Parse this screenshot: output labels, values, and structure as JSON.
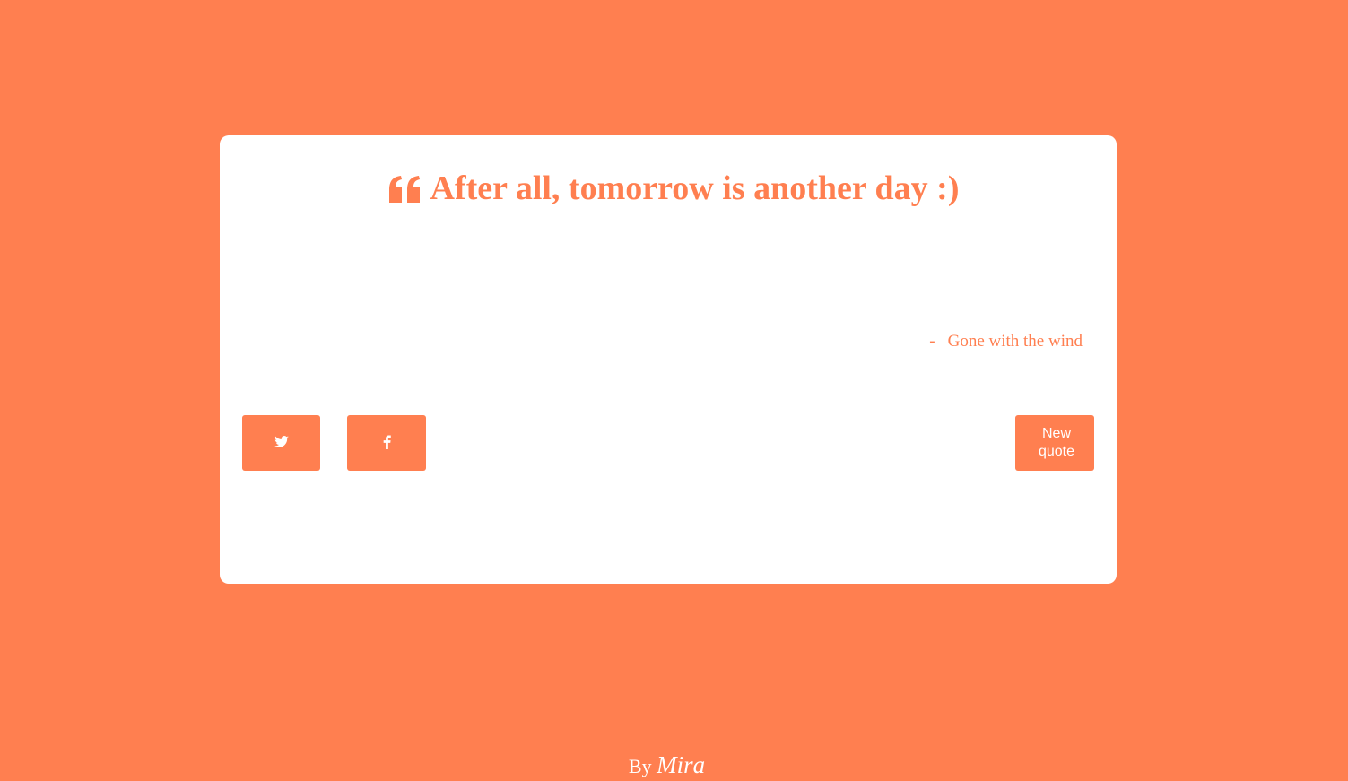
{
  "colors": {
    "accent": "#FF7F50",
    "card": "#FFFFFF",
    "text_on_accent": "#FFFFFF"
  },
  "quote": {
    "icon": "quote-left-icon",
    "text": "After all, tomorrow is another day :)",
    "dash": "-",
    "author": "Gone with the wind"
  },
  "buttons": {
    "twitter_icon": "twitter-icon",
    "facebook_icon": "facebook-icon",
    "new_quote_label": "New quote"
  },
  "footer": {
    "prefix": "By",
    "name": "Mira"
  }
}
